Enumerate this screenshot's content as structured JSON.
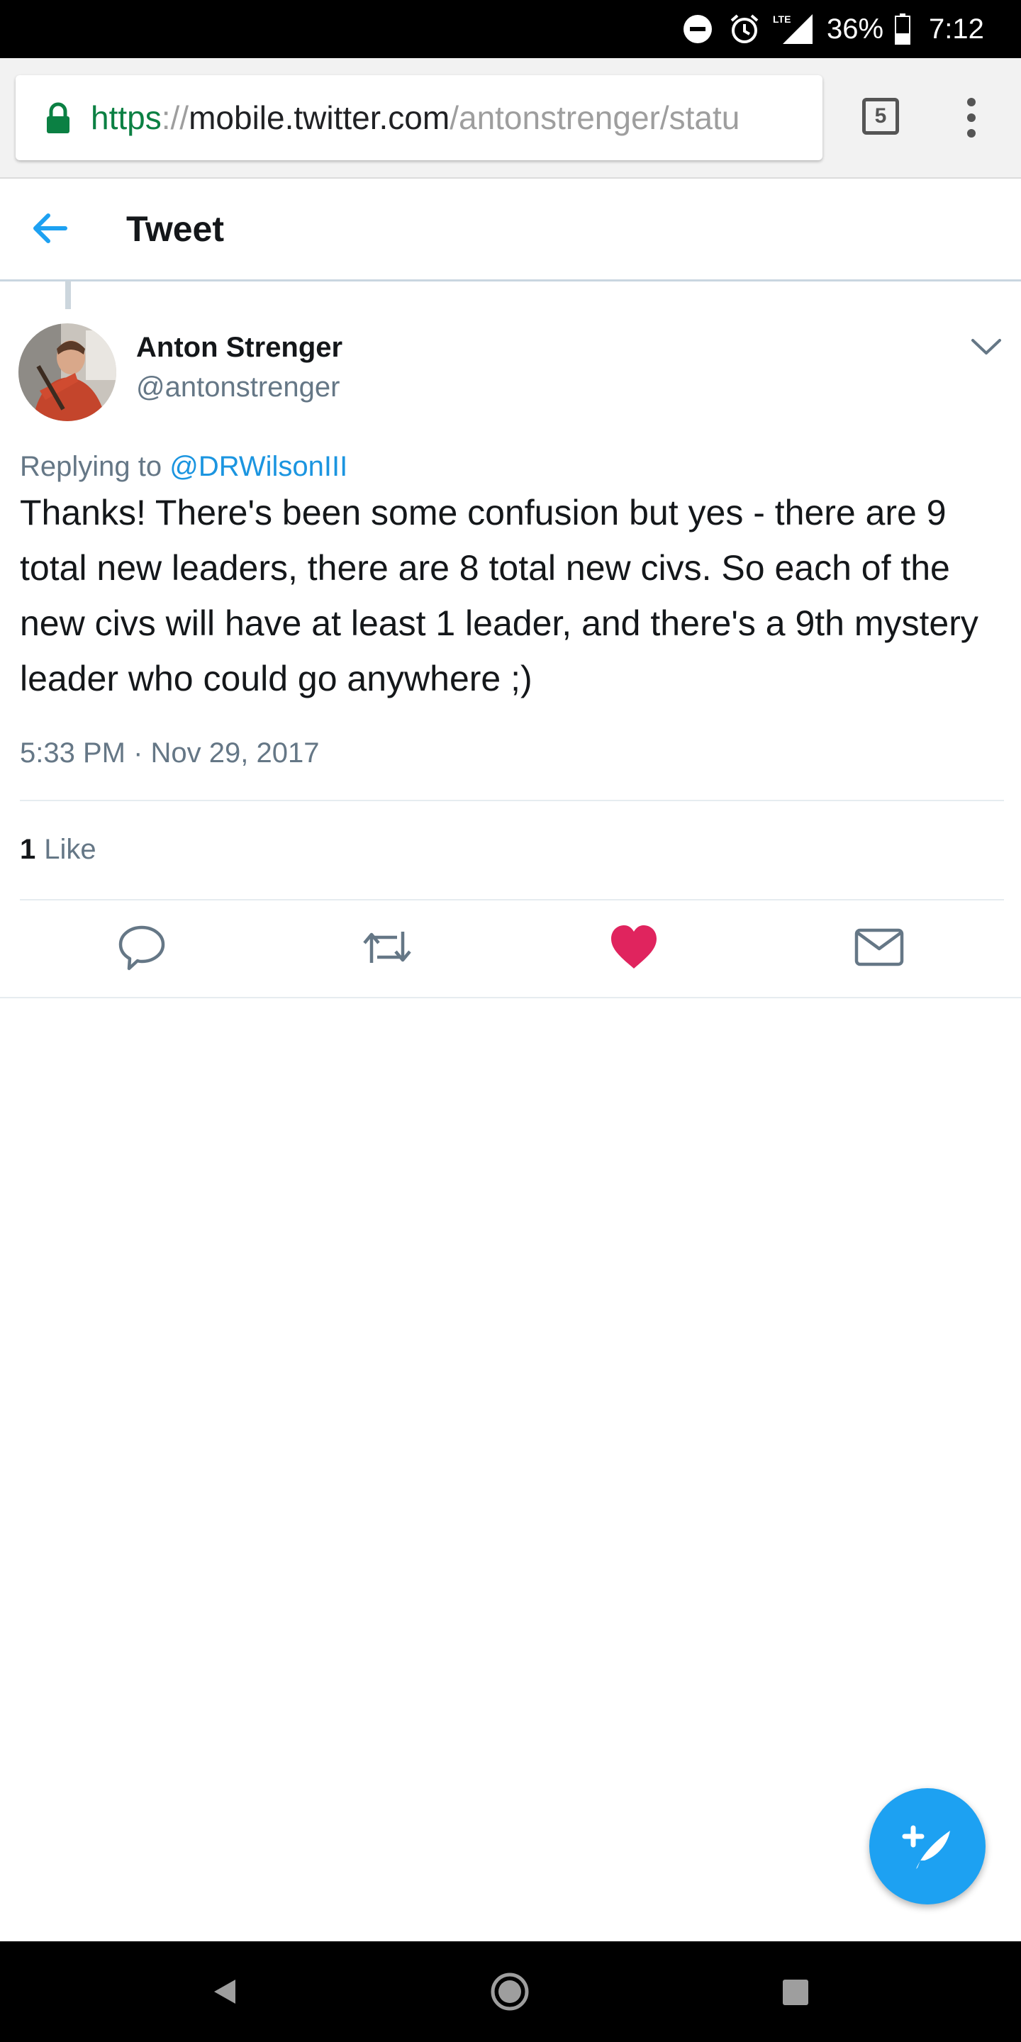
{
  "status_bar": {
    "network": "LTE",
    "battery": "36%",
    "time": "7:12",
    "icons": [
      "do-not-disturb-icon",
      "alarm-icon",
      "lte-signal-icon",
      "battery-icon"
    ]
  },
  "browser": {
    "url_scheme": "https",
    "url_separator": "://",
    "url_host": "mobile.twitter.com",
    "url_path": "/antonstrenger/statu",
    "tab_count": "5",
    "secure_color": "#0b8043"
  },
  "header": {
    "title": "Tweet"
  },
  "tweet": {
    "author_name": "Anton Strenger",
    "author_handle": "@antonstrenger",
    "replying_label": "Replying to",
    "replying_to": "@DRWilsonIII",
    "text": "Thanks! There's been some confusion but yes - there are 9 total new leaders, there are 8 total new civs. So each of the new civs will have at least 1 leader, and there's a 9th mystery leader who could go anywhere ;)",
    "timestamp": "5:33 PM · Nov 29, 2017",
    "like_count": "1",
    "like_label": "Like",
    "liked": true
  },
  "actions": [
    {
      "name": "reply",
      "icon": "reply-icon"
    },
    {
      "name": "retweet",
      "icon": "retweet-icon"
    },
    {
      "name": "like",
      "icon": "heart-icon"
    },
    {
      "name": "direct-message",
      "icon": "envelope-icon"
    }
  ],
  "colors": {
    "accent": "#1da1f2",
    "link": "#1b95e0",
    "like": "#e0245e",
    "secondary_text": "#657786",
    "primary_text": "#14171a"
  }
}
